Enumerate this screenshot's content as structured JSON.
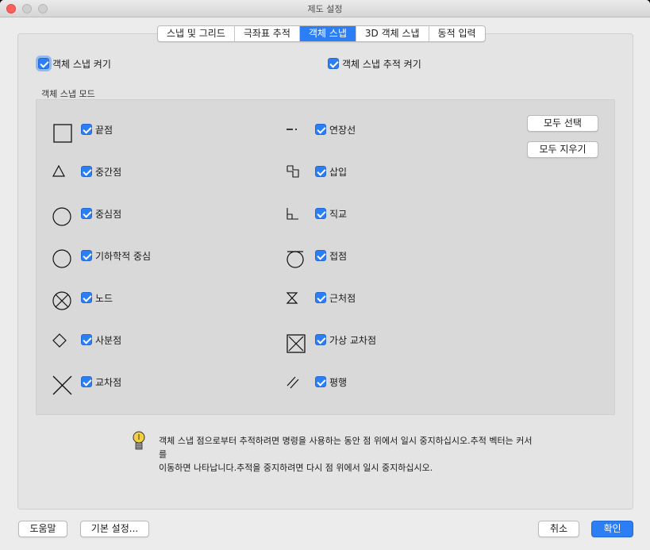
{
  "window": {
    "title": "제도 설정"
  },
  "tabs": [
    {
      "label": "스냅 및 그리드"
    },
    {
      "label": "극좌표 추적"
    },
    {
      "label": "객체 스냅",
      "active": true
    },
    {
      "label": "3D 객체 스냅"
    },
    {
      "label": "동적 입력"
    }
  ],
  "options": {
    "osnap_on": {
      "label": "객체 스냅 켜기",
      "checked": true
    },
    "osnap_tracking_on": {
      "label": "객체 스냅 추적 켜기",
      "checked": true
    }
  },
  "modes": {
    "group_label": "객체 스냅 모드",
    "left": [
      {
        "label": "끝점",
        "icon": "square-icon",
        "checked": true
      },
      {
        "label": "중간점",
        "icon": "triangle-icon",
        "checked": true
      },
      {
        "label": "중심점",
        "icon": "circle-icon",
        "checked": true
      },
      {
        "label": "기하학적 중심",
        "icon": "geometric-center-icon",
        "checked": true
      },
      {
        "label": "노드",
        "icon": "node-icon",
        "checked": true
      },
      {
        "label": "사분점",
        "icon": "diamond-icon",
        "checked": true
      },
      {
        "label": "교차점",
        "icon": "intersection-icon",
        "checked": true
      }
    ],
    "right": [
      {
        "label": "연장선",
        "icon": "extension-icon",
        "checked": true
      },
      {
        "label": "삽입",
        "icon": "insertion-icon",
        "checked": true
      },
      {
        "label": "직교",
        "icon": "perpendicular-icon",
        "checked": true
      },
      {
        "label": "접점",
        "icon": "tangent-icon",
        "checked": true
      },
      {
        "label": "근처점",
        "icon": "nearest-icon",
        "checked": true
      },
      {
        "label": "가상 교차점",
        "icon": "apparent-intersection-icon",
        "checked": true
      },
      {
        "label": "평행",
        "icon": "parallel-icon",
        "checked": true
      }
    ],
    "select_all": "모두 선택",
    "clear_all": "모두 지우기"
  },
  "hint": {
    "icon": "lightbulb-icon",
    "line1": "객체 스냅 점으로부터 추적하려면 명령을 사용하는 동안 점 위에서 일시 중지하십시오.추적 벡터는 커서를",
    "line2": "이동하면 나타납니다.추적을 중지하려면 다시 점 위에서 일시 중지하십시오."
  },
  "footer": {
    "help": "도움말",
    "defaults": "기본 설정...",
    "cancel": "취소",
    "ok": "확인"
  }
}
